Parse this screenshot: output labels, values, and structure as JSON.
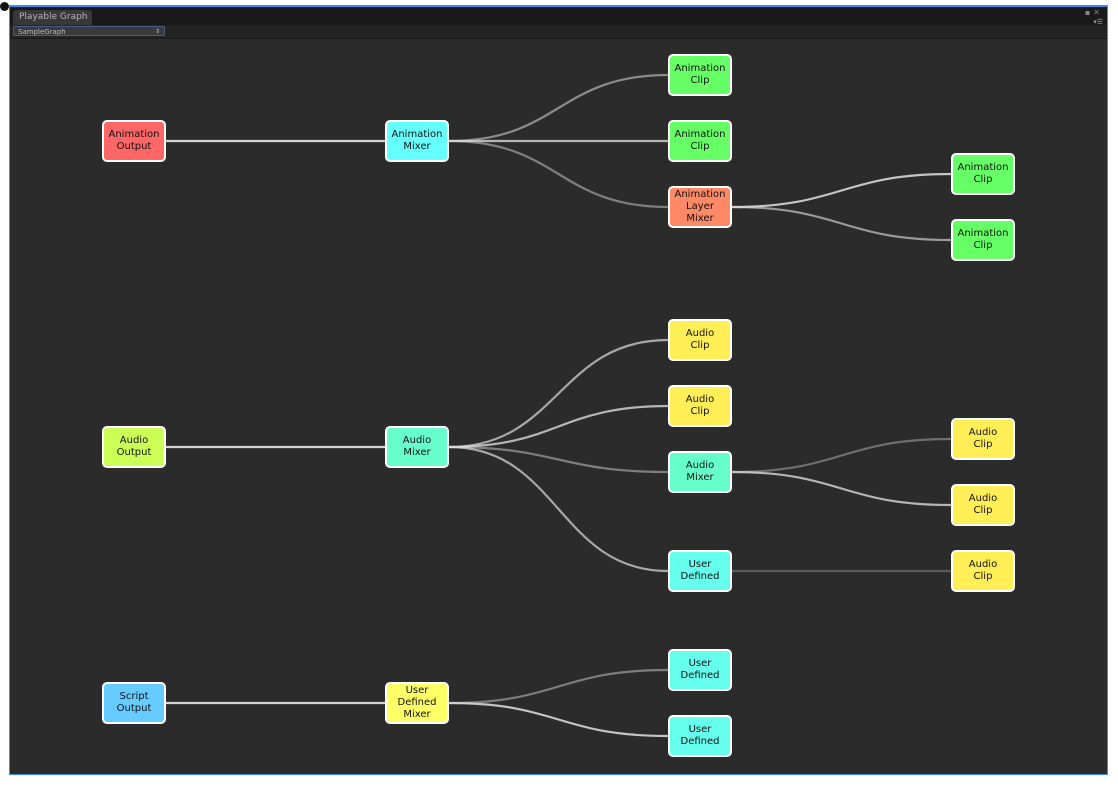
{
  "window": {
    "tab_title": "Playable Graph",
    "graph_selector": "SampleGraph",
    "accent": "#3a8ee6"
  },
  "nodes": [
    {
      "id": "ao",
      "label": "Animation\nOutput",
      "color": "#ff6666"
    },
    {
      "id": "am",
      "label": "Animation\nMixer",
      "color": "#66ffff"
    },
    {
      "id": "ac1",
      "label": "Animation\nClip",
      "color": "#66ff66"
    },
    {
      "id": "ac2",
      "label": "Animation\nClip",
      "color": "#66ff66"
    },
    {
      "id": "alm",
      "label": "Animation\nLayer\nMixer",
      "color": "#ff8866"
    },
    {
      "id": "ac3",
      "label": "Animation\nClip",
      "color": "#66ff66"
    },
    {
      "id": "ac4",
      "label": "Animation\nClip",
      "color": "#66ff66"
    },
    {
      "id": "auo",
      "label": "Audio\nOutput",
      "color": "#ccff55"
    },
    {
      "id": "aum",
      "label": "Audio\nMixer",
      "color": "#66ffcc"
    },
    {
      "id": "auc1",
      "label": "Audio\nClip",
      "color": "#ffee55"
    },
    {
      "id": "auc2",
      "label": "Audio\nClip",
      "color": "#ffee55"
    },
    {
      "id": "aum2",
      "label": "Audio\nMixer",
      "color": "#66ffcc"
    },
    {
      "id": "ud1",
      "label": "User\nDefined",
      "color": "#66ffee"
    },
    {
      "id": "auc3",
      "label": "Audio\nClip",
      "color": "#ffee55"
    },
    {
      "id": "auc4",
      "label": "Audio\nClip",
      "color": "#ffee55"
    },
    {
      "id": "auc5",
      "label": "Audio\nClip",
      "color": "#ffee55"
    },
    {
      "id": "so",
      "label": "Script\nOutput",
      "color": "#66ccff"
    },
    {
      "id": "udm",
      "label": "User\nDefined\nMixer",
      "color": "#ffff66"
    },
    {
      "id": "ud2",
      "label": "User\nDefined",
      "color": "#66ffee"
    },
    {
      "id": "ud3",
      "label": "User\nDefined",
      "color": "#66ffee"
    }
  ],
  "edges": [
    {
      "from": "ao",
      "to": "am",
      "weight": 1
    },
    {
      "from": "am",
      "to": "ac1",
      "weight": 0.5
    },
    {
      "from": "am",
      "to": "ac2",
      "weight": 0.8
    },
    {
      "from": "am",
      "to": "alm",
      "weight": 0.4
    },
    {
      "from": "alm",
      "to": "ac3",
      "weight": 0.9
    },
    {
      "from": "alm",
      "to": "ac4",
      "weight": 0.6
    },
    {
      "from": "auo",
      "to": "aum",
      "weight": 1
    },
    {
      "from": "aum",
      "to": "auc1",
      "weight": 0.7
    },
    {
      "from": "aum",
      "to": "auc2",
      "weight": 0.8
    },
    {
      "from": "aum",
      "to": "aum2",
      "weight": 0.4
    },
    {
      "from": "aum",
      "to": "ud1",
      "weight": 0.7
    },
    {
      "from": "aum2",
      "to": "auc3",
      "weight": 0.3
    },
    {
      "from": "aum2",
      "to": "auc4",
      "weight": 0.8
    },
    {
      "from": "ud1",
      "to": "auc5",
      "weight": 0.15
    },
    {
      "from": "so",
      "to": "udm",
      "weight": 1
    },
    {
      "from": "udm",
      "to": "ud2",
      "weight": 0.4
    },
    {
      "from": "udm",
      "to": "ud3",
      "weight": 0.9
    }
  ]
}
